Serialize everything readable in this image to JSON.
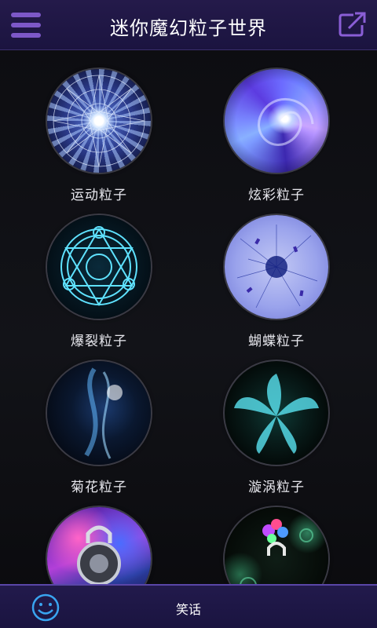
{
  "header": {
    "title": "迷你魔幻粒子世界",
    "menu_icon": "hamburger-menu-icon",
    "share_icon": "external-share-icon"
  },
  "tiles": [
    {
      "label": "运动粒子"
    },
    {
      "label": "炫彩粒子"
    },
    {
      "label": "爆裂粒子"
    },
    {
      "label": "蝴蝶粒子"
    },
    {
      "label": "菊花粒子"
    },
    {
      "label": "漩涡粒子"
    },
    {
      "label": ""
    },
    {
      "label": ""
    }
  ],
  "bottom": {
    "label": "笑话",
    "smile_icon": "smile-icon"
  },
  "colors": {
    "header_bg": "#1b1440",
    "accent": "#7d58c8",
    "text": "#ffffff"
  }
}
